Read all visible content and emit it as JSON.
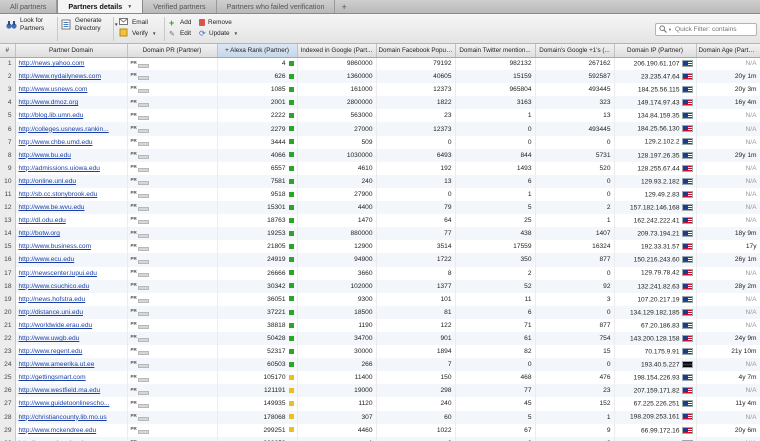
{
  "tabs": [
    {
      "label": "All partners",
      "active": false
    },
    {
      "label": "Partners details",
      "active": true
    },
    {
      "label": "Verified partners",
      "active": false
    },
    {
      "label": "Partners who failed verification",
      "active": false
    }
  ],
  "tab_add_label": "+",
  "toolbar": {
    "look_for_partners": "Look for Partners",
    "generate_directory": "Generate Directory",
    "email": "Email",
    "verify": "Verify",
    "add": "Add",
    "edit": "Edit",
    "remove": "Remove",
    "update": "Update",
    "filter_placeholder": "Quick Filter: contains"
  },
  "columns": [
    "#",
    "Partner Domain",
    "Domain PR (Partner)",
    "+ Alexa Rank (Partner)",
    "Indexed in Google (Part...",
    "Domain Facebook Popul...",
    "Domain Twitter mention...",
    "Domain's Google +1's (...",
    "Domain IP (Partner)",
    "Domain Age (Partner)"
  ],
  "colors": {
    "green": "#2aa52a",
    "yellow": "#e8c020",
    "link": "#1a3fa8"
  },
  "rows": [
    {
      "n": "1",
      "domain": "http://news.yahoo.com",
      "alexa": "4",
      "color": "green",
      "google": "9860000",
      "fb": "79192",
      "tw": "982132",
      "gplus": "267162",
      "ip": "206.190.61.107",
      "flag": "us",
      "age": "N/A"
    },
    {
      "n": "2",
      "domain": "http://www.nydailynews.com",
      "alexa": "626",
      "color": "green",
      "google": "1360000",
      "fb": "40605",
      "tw": "15159",
      "gplus": "592587",
      "ip": "23.235.47.64",
      "flag": "us",
      "age": "20y 1m"
    },
    {
      "n": "3",
      "domain": "http://www.usnews.com",
      "alexa": "1085",
      "color": "green",
      "google": "161000",
      "fb": "12373",
      "tw": "965804",
      "gplus": "493445",
      "ip": "184.25.56.115",
      "flag": "us",
      "age": "20y 3m"
    },
    {
      "n": "4",
      "domain": "http://www.dmoz.org",
      "alexa": "2001",
      "color": "green",
      "google": "2800000",
      "fb": "1822",
      "tw": "3163",
      "gplus": "323",
      "ip": "149.174.97.43",
      "flag": "us",
      "age": "16y 4m"
    },
    {
      "n": "5",
      "domain": "http://blog.lib.umn.edu",
      "alexa": "2222",
      "color": "green",
      "google": "563000",
      "fb": "23",
      "tw": "1",
      "gplus": "13",
      "ip": "134.84.159.35",
      "flag": "us",
      "age": "N/A"
    },
    {
      "n": "6",
      "domain": "http://colleges.usnews.rankin...",
      "alexa": "2279",
      "color": "green",
      "google": "27000",
      "fb": "12373",
      "tw": "0",
      "gplus": "493445",
      "ip": "184.25.56.130",
      "flag": "us",
      "age": "N/A"
    },
    {
      "n": "7",
      "domain": "http://www.chbe.umd.edu",
      "alexa": "3444",
      "color": "green",
      "google": "509",
      "fb": "0",
      "tw": "0",
      "gplus": "0",
      "ip": "129.2.102.2",
      "flag": "us",
      "age": "N/A"
    },
    {
      "n": "8",
      "domain": "http://www.bu.edu",
      "alexa": "4066",
      "color": "green",
      "google": "1030000",
      "fb": "6493",
      "tw": "844",
      "gplus": "5731",
      "ip": "128.197.26.35",
      "flag": "us",
      "age": "29y 1m"
    },
    {
      "n": "9",
      "domain": "http://admissions.uiowa.edu",
      "alexa": "6557",
      "color": "green",
      "google": "4610",
      "fb": "192",
      "tw": "1493",
      "gplus": "520",
      "ip": "128.255.67.44",
      "flag": "us",
      "age": "N/A"
    },
    {
      "n": "10",
      "domain": "http://online.unl.edu",
      "alexa": "7581",
      "color": "green",
      "google": "240",
      "fb": "13",
      "tw": "6",
      "gplus": "0",
      "ip": "129.93.2.182",
      "flag": "us",
      "age": "N/A"
    },
    {
      "n": "11",
      "domain": "http://sb.cc.stonybrook.edu",
      "alexa": "9518",
      "color": "green",
      "google": "27900",
      "fb": "0",
      "tw": "1",
      "gplus": "0",
      "ip": "129.49.2.83",
      "flag": "us",
      "age": "N/A"
    },
    {
      "n": "12",
      "domain": "http://www.be.wvu.edu",
      "alexa": "15301",
      "color": "green",
      "google": "4400",
      "fb": "79",
      "tw": "5",
      "gplus": "2",
      "ip": "157.182.146.168",
      "flag": "us",
      "age": "N/A"
    },
    {
      "n": "13",
      "domain": "http://dl.odu.edu",
      "alexa": "18763",
      "color": "green",
      "google": "1470",
      "fb": "64",
      "tw": "25",
      "gplus": "1",
      "ip": "162.242.222.41",
      "flag": "us",
      "age": "N/A"
    },
    {
      "n": "14",
      "domain": "http://botw.org",
      "alexa": "19253",
      "color": "green",
      "google": "880000",
      "fb": "77",
      "tw": "438",
      "gplus": "1407",
      "ip": "209.73.194.21",
      "flag": "us",
      "age": "18y 9m"
    },
    {
      "n": "15",
      "domain": "http://www.business.com",
      "alexa": "21805",
      "color": "green",
      "google": "12900",
      "fb": "3514",
      "tw": "17559",
      "gplus": "16324",
      "ip": "192.33.31.57",
      "flag": "us",
      "age": "17y"
    },
    {
      "n": "16",
      "domain": "http://www.ecu.edu",
      "alexa": "24919",
      "color": "green",
      "google": "94900",
      "fb": "1722",
      "tw": "350",
      "gplus": "877",
      "ip": "150.216.243.60",
      "flag": "us",
      "age": "26y 1m"
    },
    {
      "n": "17",
      "domain": "http://newscenter.lupui.edu",
      "alexa": "26666",
      "color": "green",
      "google": "3660",
      "fb": "8",
      "tw": "2",
      "gplus": "0",
      "ip": "129.79.78.42",
      "flag": "us",
      "age": "N/A"
    },
    {
      "n": "18",
      "domain": "http://www.csuchico.edu",
      "alexa": "30342",
      "color": "green",
      "google": "102000",
      "fb": "1377",
      "tw": "52",
      "gplus": "92",
      "ip": "132.241.82.63",
      "flag": "us",
      "age": "28y 2m"
    },
    {
      "n": "19",
      "domain": "http://news.hofstra.edu",
      "alexa": "36051",
      "color": "green",
      "google": "9300",
      "fb": "101",
      "tw": "11",
      "gplus": "3",
      "ip": "107.20.217.19",
      "flag": "us",
      "age": "N/A"
    },
    {
      "n": "20",
      "domain": "http://distance.uni.edu",
      "alexa": "37221",
      "color": "green",
      "google": "18500",
      "fb": "81",
      "tw": "6",
      "gplus": "0",
      "ip": "134.129.182.185",
      "flag": "us",
      "age": "N/A"
    },
    {
      "n": "21",
      "domain": "http://worldwide.erau.edu",
      "alexa": "38818",
      "color": "green",
      "google": "1190",
      "fb": "122",
      "tw": "71",
      "gplus": "877",
      "ip": "67.20.186.83",
      "flag": "us",
      "age": "N/A"
    },
    {
      "n": "22",
      "domain": "http://www.uwgb.edu",
      "alexa": "50428",
      "color": "green",
      "google": "34700",
      "fb": "901",
      "tw": "61",
      "gplus": "754",
      "ip": "143.200.128.158",
      "flag": "us",
      "age": "24y 9m"
    },
    {
      "n": "23",
      "domain": "http://www.regent.edu",
      "alexa": "52317",
      "color": "green",
      "google": "30000",
      "fb": "1894",
      "tw": "82",
      "gplus": "15",
      "ip": "70.175.9.91",
      "flag": "us",
      "age": "21y 10m"
    },
    {
      "n": "24",
      "domain": "http://www.ameerika.ut.ee",
      "alexa": "60503",
      "color": "green",
      "google": "266",
      "fb": "7",
      "tw": "0",
      "gplus": "0",
      "ip": "193.40.5.227",
      "flag": "ee",
      "age": "N/A"
    },
    {
      "n": "25",
      "domain": "http://gettingsmart.com",
      "alexa": "105170",
      "color": "yellow",
      "google": "11400",
      "fb": "150",
      "tw": "468",
      "gplus": "476",
      "ip": "198.154.226.93",
      "flag": "us",
      "age": "4y 7m"
    },
    {
      "n": "26",
      "domain": "http://www.westfield.ma.edu",
      "alexa": "121191",
      "color": "yellow",
      "google": "19000",
      "fb": "298",
      "tw": "77",
      "gplus": "23",
      "ip": "207.159.171.82",
      "flag": "us",
      "age": "N/A"
    },
    {
      "n": "27",
      "domain": "http://www.guidetoonlinescho...",
      "alexa": "149935",
      "color": "yellow",
      "google": "1120",
      "fb": "240",
      "tw": "45",
      "gplus": "152",
      "ip": "67.225.226.251",
      "flag": "us",
      "age": "11y 4m"
    },
    {
      "n": "28",
      "domain": "http://christiancounty.lib.mo.us",
      "alexa": "178068",
      "color": "yellow",
      "google": "307",
      "fb": "60",
      "tw": "5",
      "gplus": "1",
      "ip": "198.209.253.161",
      "flag": "us",
      "age": "N/A"
    },
    {
      "n": "29",
      "domain": "http://www.mckendree.edu",
      "alexa": "299251",
      "color": "yellow",
      "google": "4460",
      "fb": "1022",
      "tw": "67",
      "gplus": "9",
      "ip": "66.99.172.16",
      "flag": "us",
      "age": "20y 6m"
    },
    {
      "n": "30",
      "domain": "http://research.sals.edu",
      "alexa": "303959",
      "color": "yellow",
      "google": "1",
      "fb": "0",
      "tw": "0",
      "gplus": "0",
      "ip": "198.175.242.230",
      "flag": "us",
      "age": "N/A"
    }
  ]
}
